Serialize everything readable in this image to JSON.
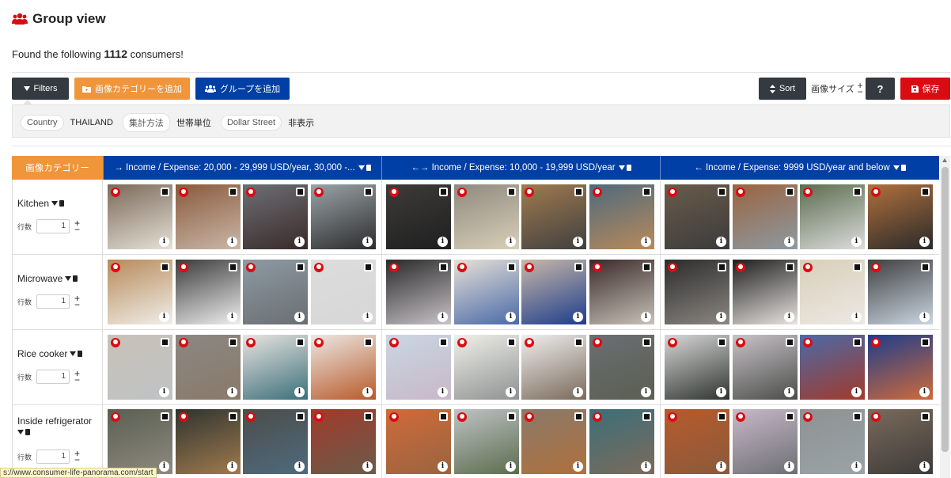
{
  "page": {
    "title": "Group view",
    "found_prefix": "Found the following",
    "found_count": "1112",
    "found_suffix": "consumers!"
  },
  "toolbar": {
    "filters_label": "Filters",
    "add_category_label": "画像カテゴリーを追加",
    "add_group_label": "グループを追加",
    "sort_label": "Sort",
    "image_size_label": "画像サイズ",
    "help_label": "?",
    "save_label": "保存"
  },
  "filters": [
    {
      "key": "Country",
      "value": "THAILAND"
    },
    {
      "key": "集計方法",
      "value": "世帯単位"
    },
    {
      "key": "Dollar Street",
      "value": "非表示"
    }
  ],
  "table": {
    "category_header": "画像カテゴリー",
    "groups": [
      {
        "label": "→ Income / Expense: 20,000 - 29,999 USD/year, 30,000 -..."
      },
      {
        "label": "←→ Income / Expense: 10,000 - 19,999 USD/year"
      },
      {
        "label": "← Income / Expense: 9999 USD/year and below"
      }
    ],
    "rows_count_label": "行数",
    "rows": [
      {
        "name": "Kitchen",
        "count": "1"
      },
      {
        "name": "Microwave",
        "count": "1"
      },
      {
        "name": "Rice cooker",
        "count": "1"
      },
      {
        "name": "Inside refrigerator",
        "count": "1"
      }
    ]
  },
  "statusbar": {
    "url": "s://www.consumer-life-panorama.com/start"
  },
  "colors": {
    "dark": "#343a40",
    "orange": "#f0953a",
    "blue": "#003fa5",
    "red": "#d90c12"
  }
}
